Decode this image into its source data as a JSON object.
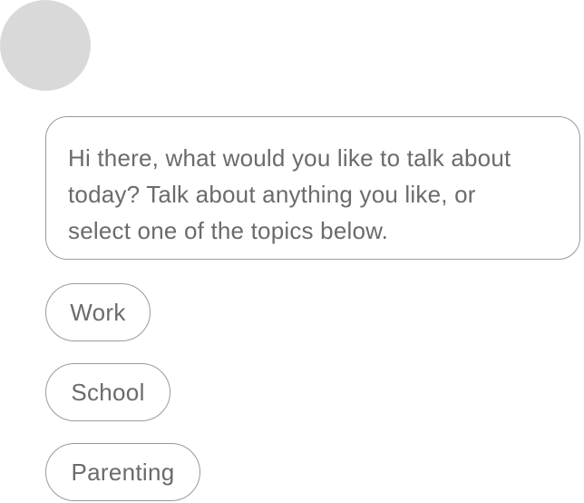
{
  "chat": {
    "message": "Hi there, what would you like to talk about today? Talk about anything you like, or select one of the topics below."
  },
  "topics": [
    {
      "label": "Work"
    },
    {
      "label": "School"
    },
    {
      "label": "Parenting"
    }
  ],
  "colors": {
    "avatar": "#d9d9d9",
    "border": "#9a9a9a",
    "text": "#6b6b6b",
    "background": "#ffffff"
  }
}
